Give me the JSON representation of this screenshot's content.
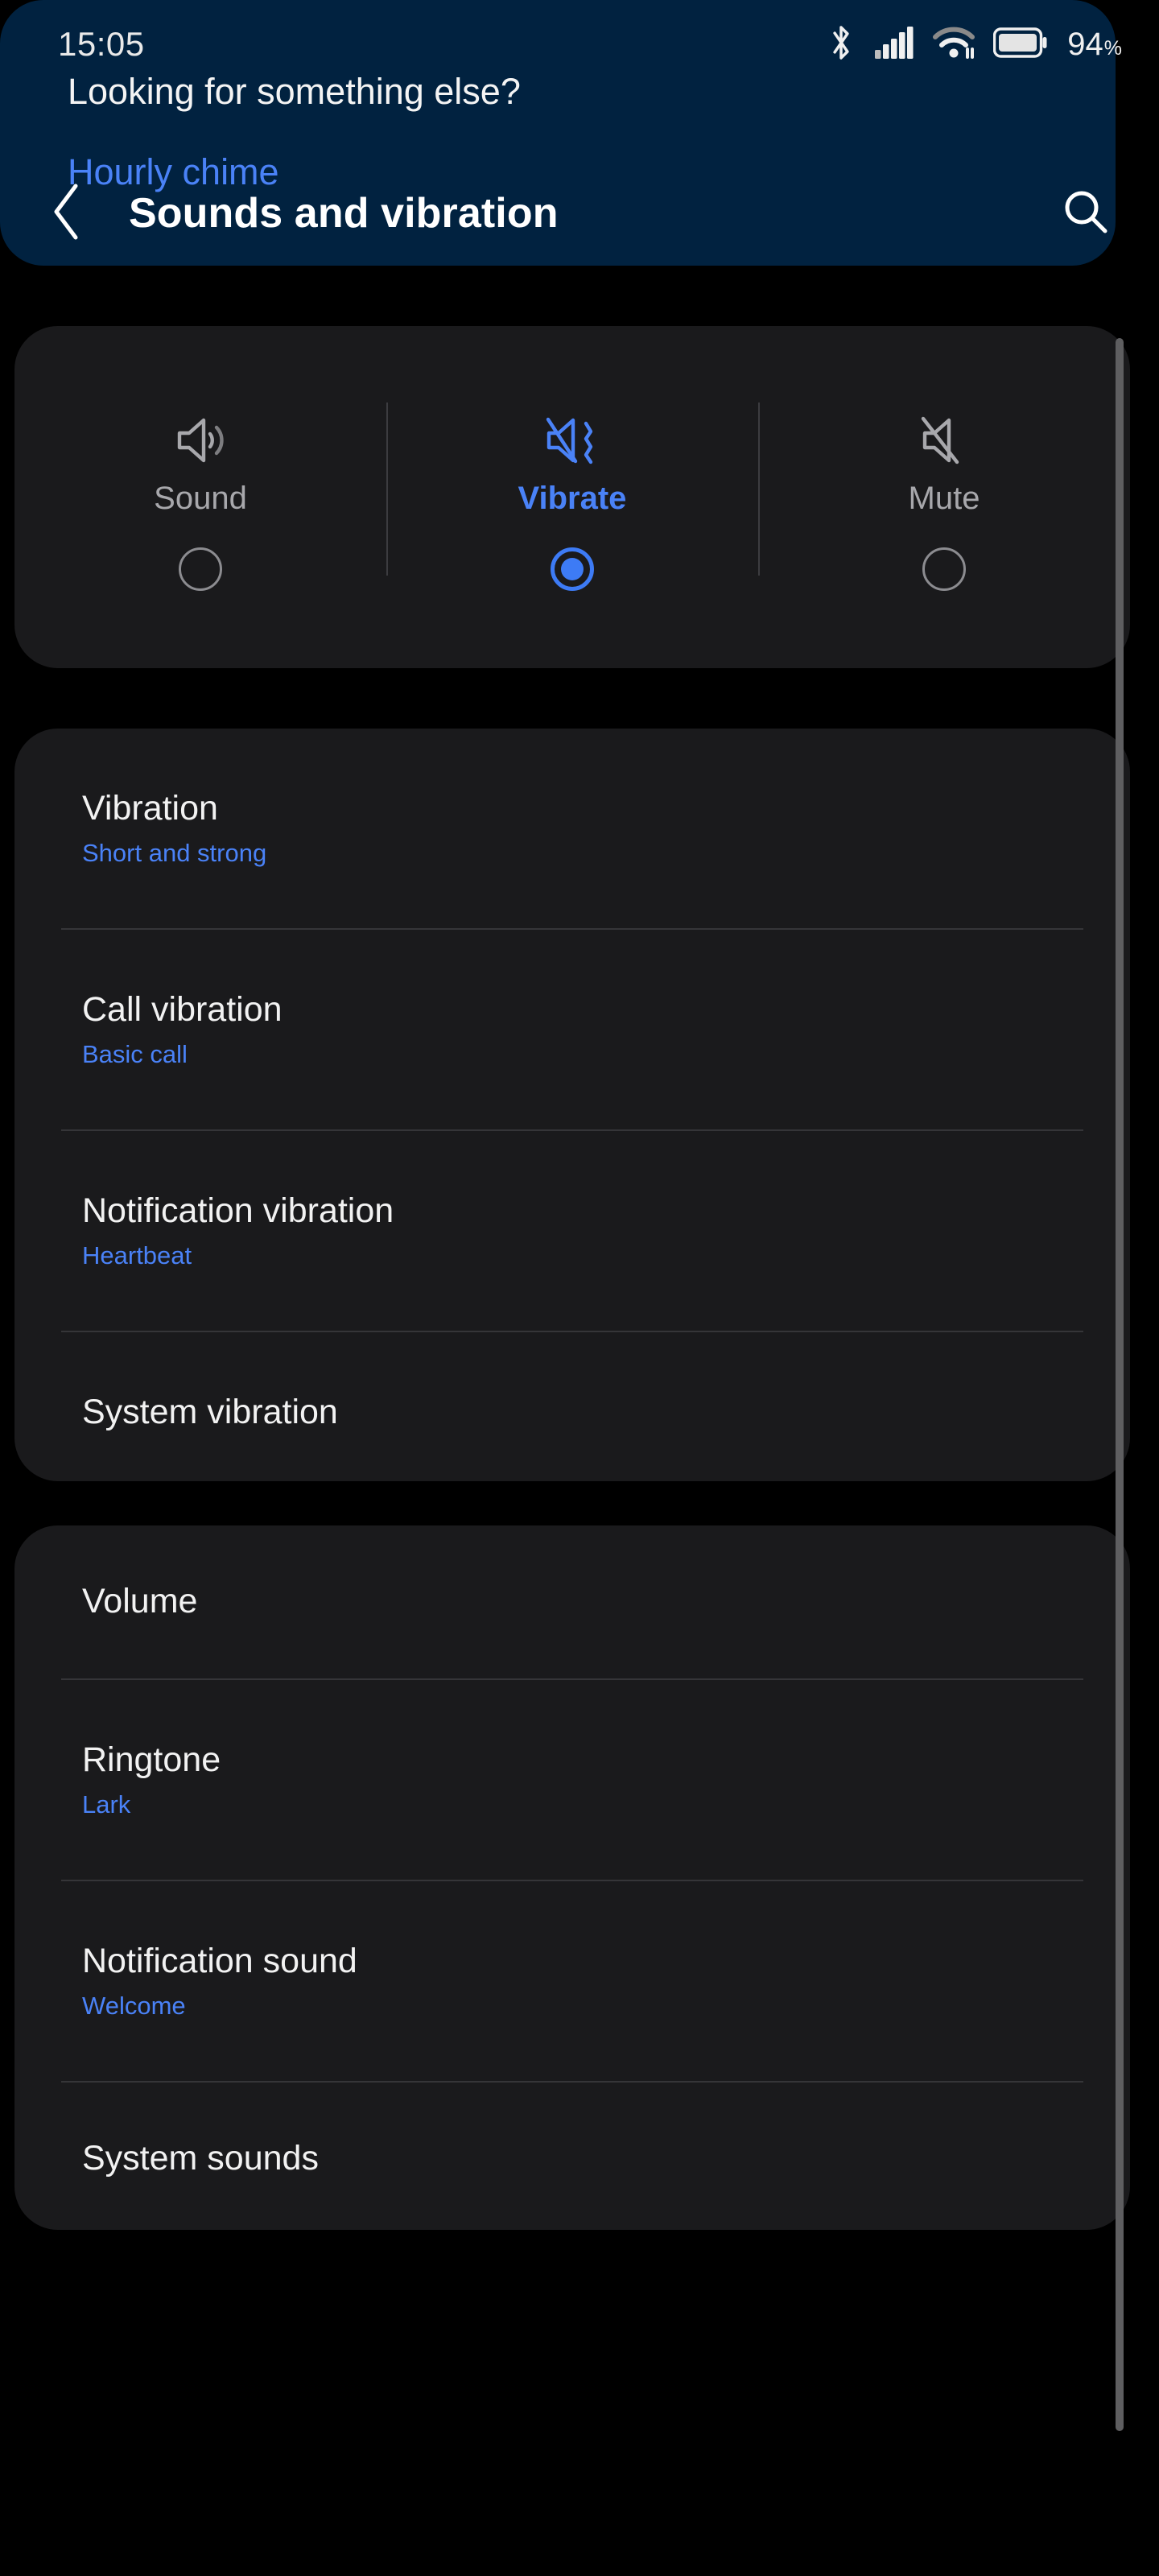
{
  "status_bar": {
    "time": "15:05",
    "battery_percent": "94",
    "percent_symbol": "%",
    "icons": [
      "bluetooth-icon",
      "cellular-signal-icon",
      "wifi-icon",
      "battery-icon"
    ],
    "signal_bars_filled": 4,
    "signal_bars_total": 5
  },
  "app_bar": {
    "back_icon": "chevron-left-icon",
    "title": "Sounds and vibration",
    "search_icon": "search-icon"
  },
  "sound_mode": {
    "options": [
      {
        "label": "Sound",
        "icon": "speaker-on-icon",
        "selected": false
      },
      {
        "label": "Vibrate",
        "icon": "speaker-vibrate-icon",
        "selected": true
      },
      {
        "label": "Mute",
        "icon": "speaker-muted-icon",
        "selected": false
      }
    ],
    "selected_index": 1
  },
  "vibration_section": {
    "items": [
      {
        "title": "Vibration",
        "subtitle": "Short and strong"
      },
      {
        "title": "Call vibration",
        "subtitle": "Basic call"
      },
      {
        "title": "Notification vibration",
        "subtitle": "Heartbeat"
      },
      {
        "title": "System vibration",
        "subtitle": ""
      }
    ]
  },
  "sound_section": {
    "items": [
      {
        "title": "Volume",
        "subtitle": ""
      },
      {
        "title": "Ringtone",
        "subtitle": "Lark"
      },
      {
        "title": "Notification sound",
        "subtitle": "Welcome"
      },
      {
        "title": "System sounds",
        "subtitle": ""
      }
    ]
  },
  "suggestion": {
    "title": "Looking for something else?",
    "link": "Hourly chime"
  },
  "colors": {
    "accent_blue": "#4a82f7",
    "radio_blue": "#3d7bf5",
    "card_bg": "#1a1a1c",
    "suggestion_bg": "#012240",
    "page_bg": "#000000",
    "divider": "#353538",
    "title_text": "#f2f2f2",
    "muted_text": "#a8a8ac"
  }
}
